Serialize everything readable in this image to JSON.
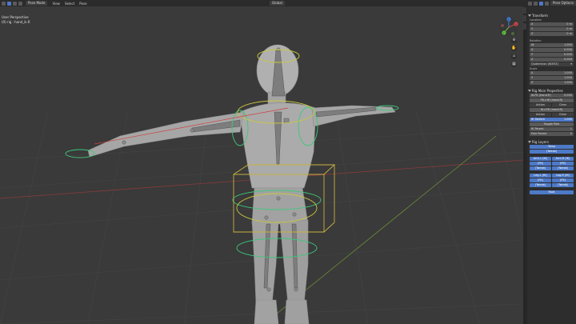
{
  "header": {
    "mode": "Pose Mode",
    "menus": [
      "View",
      "Select",
      "Pose"
    ],
    "orientation": "Global",
    "options_label": "Pose Options"
  },
  "viewport": {
    "view_name": "User Perspective",
    "object_name": "(0) rig : hand_ik.R"
  },
  "gizmo": {
    "x_label": "X",
    "y_label": "Y",
    "z_label": "Z"
  },
  "panel": {
    "transform": {
      "title": "Transform",
      "location_label": "Location",
      "location": [
        {
          "axis": "X",
          "value": "0 m"
        },
        {
          "axis": "Y",
          "value": "0 m"
        },
        {
          "axis": "Z",
          "value": "0 m"
        }
      ],
      "rotation_label": "Rotation",
      "rotation": [
        {
          "axis": "W",
          "value": "1.000"
        },
        {
          "axis": "X",
          "value": "0.000"
        },
        {
          "axis": "Y",
          "value": "0.000"
        },
        {
          "axis": "Z",
          "value": "0.000"
        }
      ],
      "rotation_mode": "Quaternion (WXYZ)",
      "scale_label": "Scale",
      "scale": [
        {
          "axis": "X",
          "value": "1.000"
        },
        {
          "axis": "Y",
          "value": "1.000"
        },
        {
          "axis": "Z",
          "value": "1.000"
        }
      ]
    },
    "rig_main": {
      "title": "Rig Main Properties",
      "ik_fk": "IK-FK (hand.R)",
      "ik_fk_value": "0.000",
      "fk_ik_button": "FK->IK (hand.R)",
      "snap_labels": [
        "Action",
        "Clear"
      ],
      "ik_fk_button": "IK->FK (hand.R)",
      "ik_stretch": "IK Stretch",
      "ik_stretch_value": "1.000",
      "toggle_pole": "Toggle Pole",
      "ik_parent": "IK Parent",
      "ik_parent_value": "1",
      "pole_parent": "Pole Parent",
      "pole_parent_value": "0"
    },
    "rig_layers": {
      "title": "Rig Layers",
      "torso": "Torso",
      "tweak": "(Tweak)",
      "arm_l_ik": "Arm.L (IK)",
      "arm_r_ik": "Arm.R (IK)",
      "fk": "(FK)",
      "leg_l_ik": "Leg.L (IK)",
      "leg_r_ik": "Leg.R (IK)",
      "root": "Root"
    }
  },
  "colors": {
    "accent": "#4d79c7",
    "panel_bg": "#2d2d2d",
    "viewport_bg": "#3a3a3a"
  }
}
